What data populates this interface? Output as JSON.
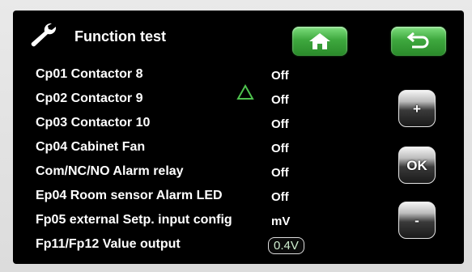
{
  "header": {
    "title": "Function test",
    "wrench_icon": "wrench-icon",
    "home_icon": "home-icon",
    "back_icon": "back-icon",
    "accent_color": "#3ea83e"
  },
  "rows": [
    {
      "label": "Cp01 Contactor 8",
      "value": "Off"
    },
    {
      "label": "Cp02 Contactor 9",
      "value": "Off"
    },
    {
      "label": "Cp03 Contactor 10",
      "value": "Off"
    },
    {
      "label": "Cp04 Cabinet Fan",
      "value": "Off"
    },
    {
      "label": "Com/NC/NO Alarm relay",
      "value": "Off"
    },
    {
      "label": "Ep04 Room sensor Alarm LED",
      "value": "Off"
    },
    {
      "label": "Fp05 external Setp. input config",
      "value": "mV"
    },
    {
      "label": "Fp11/Fp12 Value output",
      "value": "0.4V"
    }
  ],
  "indicator": {
    "icon": "triangle-up-icon",
    "color": "#4ec24e"
  },
  "side_buttons": {
    "plus": "+",
    "ok": "OK",
    "minus": "-"
  }
}
